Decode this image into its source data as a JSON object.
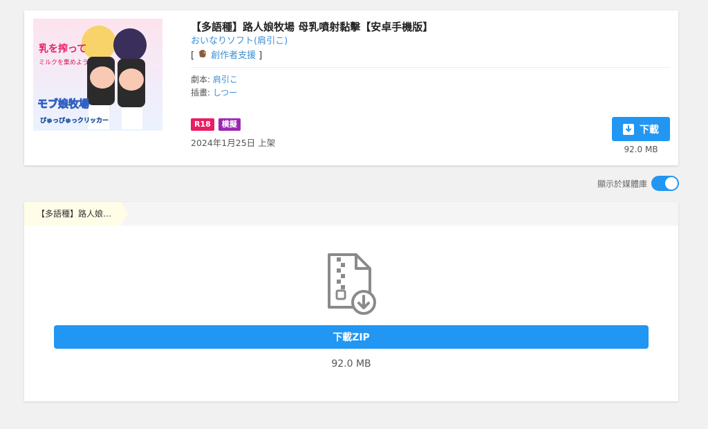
{
  "work": {
    "title": "【多語種】路人娘牧場 母乳噴射黏擊【安卓手機版】",
    "circle": "おいなりソフト(肩引こ)",
    "support_prefix": "[",
    "support_label": "創作者支援",
    "support_suffix": "]",
    "scenario_label": "劇本: ",
    "scenario_value": "肩引こ",
    "illustration_label": "插畫: ",
    "illustration_value": "しつー",
    "tags": [
      {
        "label": "R18",
        "color": "#e91e63"
      },
      {
        "label": "模擬",
        "color": "#9c27b0"
      }
    ],
    "release": "2024年1月25日 上架",
    "download_label": "下載",
    "size": "92.0 MB",
    "cover": {
      "text1": "乳を搾って",
      "text2": "ミルクを集めよう",
      "text3": "モブ娘牧場",
      "text4": "ぴゅっぴゅっクリッカー"
    }
  },
  "media_toggle": {
    "label": "顯示於媒體庫",
    "on": true
  },
  "panel": {
    "tab_label": "【多語種】路人娘…",
    "zip_button": "下載ZIP",
    "size": "92.0 MB"
  },
  "colors": {
    "accent": "#2196f3",
    "link": "#3a8fd6"
  }
}
